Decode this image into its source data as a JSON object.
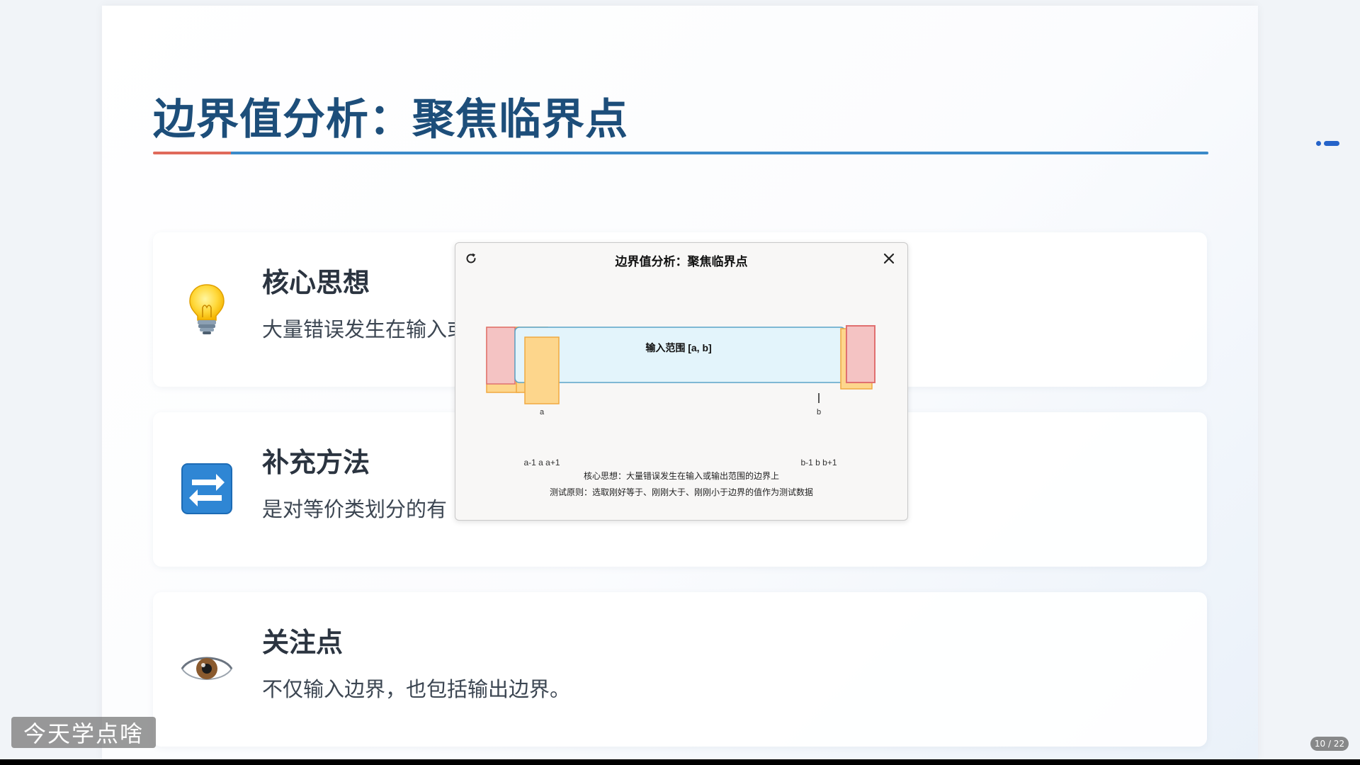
{
  "slide": {
    "title": "边界值分析：聚焦临界点",
    "cards": [
      {
        "icon": "lightbulb-icon",
        "title": "核心思想",
        "desc": "大量错误发生在输入或"
      },
      {
        "icon": "arrows-cycle-icon",
        "title": "补充方法",
        "desc": "是对等价类划分的有"
      },
      {
        "icon": "eye-icon",
        "title": "关注点",
        "desc": "不仅输入边界，也包括输出边界。"
      }
    ]
  },
  "modal": {
    "title": "边界值分析：聚焦临界点",
    "diagram": {
      "range_label": "输入范围 [a, b]",
      "label_a": "a",
      "label_b": "b",
      "label_left_points": "a-1 a a+1",
      "label_right_points": "b-1 b b+1"
    },
    "note1": "核心思想：大量错误发生在输入或输出范围的边界上",
    "note2": "测试原则：选取刚好等于、刚刚大于、刚刚小于边界的值作为测试数据"
  },
  "watermark": "今天学点啥",
  "page_counter": "10 / 22",
  "colors": {
    "title": "#1d4e7a",
    "rule_red": "#e06a5a",
    "rule_blue": "#3a8ac9",
    "range_fill": "#e3f4fb",
    "range_stroke": "#5aa4c8",
    "boundary_red": "#f4c3c3",
    "boundary_orange": "#fdd68c",
    "nav_blue": "#2563c9"
  }
}
